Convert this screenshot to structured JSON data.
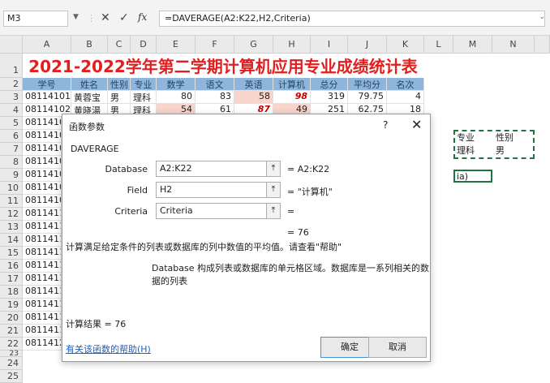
{
  "formula_bar": {
    "name_box": "M3",
    "cancel_icon": "✕",
    "enter_icon": "✓",
    "fx_label": "fx",
    "formula": "=DAVERAGE(A2:K22,H2,Criteria)"
  },
  "columns": [
    "A",
    "B",
    "C",
    "D",
    "E",
    "F",
    "G",
    "H",
    "I",
    "J",
    "K",
    "L",
    "M",
    "N"
  ],
  "rows": [
    "1",
    "2",
    "3",
    "4",
    "5",
    "6",
    "7",
    "8",
    "9",
    "10",
    "11",
    "12",
    "13",
    "14",
    "15",
    "16",
    "17",
    "18",
    "19",
    "20",
    "21",
    "22",
    "23",
    "24",
    "25"
  ],
  "sheet_title": "2021-2022学年第二学期计算机应用专业成绩统计表",
  "table_header": [
    "学号",
    "姓名",
    "性别",
    "专业",
    "数学",
    "语文",
    "英语",
    "计算机",
    "总分",
    "平均分",
    "名次"
  ],
  "row3": [
    "08114101",
    "黄蓉宝",
    "男",
    "理科",
    "80",
    "83",
    "58",
    "98",
    "319",
    "79.75",
    "4"
  ],
  "row4": [
    "08114102",
    "黄晓湯",
    "男",
    "理科",
    "54",
    "61",
    "87",
    "49",
    "251",
    "62.75",
    "18"
  ],
  "ids": [
    "0811410",
    "0811410",
    "0811410",
    "0811410",
    "0811410",
    "0811410",
    "0811410",
    "0811411",
    "0811411",
    "0811411",
    "0811411",
    "0811411",
    "0811411",
    "0811411",
    "0811411",
    "0811411",
    "0811411",
    "0811412"
  ],
  "criteria": {
    "h1": "专业",
    "h2": "性别",
    "v1": "理科",
    "v2": "男",
    "input": "ia)"
  },
  "dialog": {
    "title": "函数参数",
    "help_icon": "?",
    "close_icon": "✕",
    "function_name": "DAVERAGE",
    "args": [
      {
        "label": "Database",
        "value": "A2:K22",
        "result": "=  A2:K22"
      },
      {
        "label": "Field",
        "value": "H2",
        "result": "=  \"计算机\""
      },
      {
        "label": "Criteria",
        "value": "Criteria",
        "result": "="
      }
    ],
    "result_line": "=  76",
    "description": "计算满足给定条件的列表或数据库的列中数值的平均值。请查看\"帮助\"",
    "arg_description": "Database  构成列表或数据库的单元格区域。数据库是一系列相关的数据的列表",
    "calc_result": "计算结果 =  76",
    "help_link": "有关该函数的帮助(H)",
    "ok": "确定",
    "cancel": "取消"
  }
}
